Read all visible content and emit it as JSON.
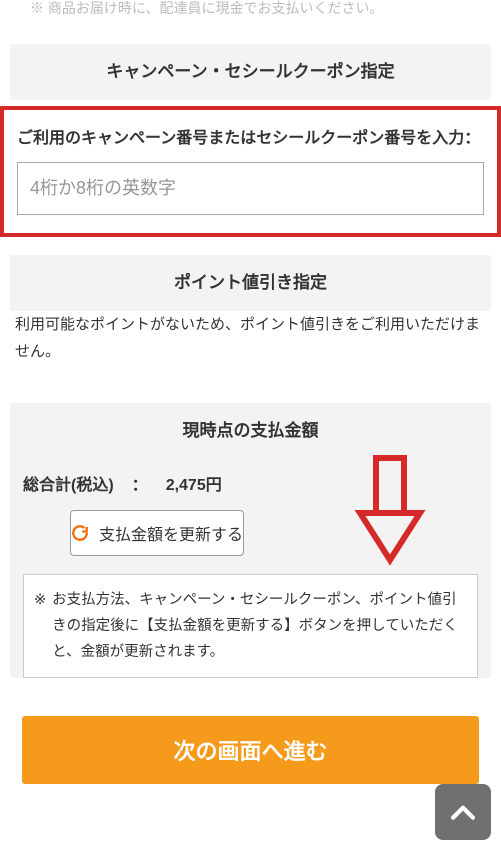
{
  "top_note": "※ 商品お届け時に、配達員に現金でお支払いください。",
  "campaign": {
    "heading": "キャンペーン・セシールクーポン指定",
    "label": "ご利用のキャンペーン番号またはセシールクーポン番号を入力：",
    "placeholder": "4桁か8桁の英数字"
  },
  "points": {
    "heading": "ポイント値引き指定",
    "body": "利用可能なポイントがないため、ポイント値引きをご利用いただけません。"
  },
  "payment": {
    "heading": "現時点の支払金額",
    "total_label": "総合計(税込)",
    "sep": "：",
    "total_value": "2,475円",
    "refresh_label": "支払金額を更新する",
    "note_marker": "※",
    "note": "お支払方法、キャンペーン・セシールクーポン、ポイント値引きの指定後に【支払金額を更新する】ボタンを押していただくと、金額が更新されます。"
  },
  "next_label": "次の画面へ進む"
}
